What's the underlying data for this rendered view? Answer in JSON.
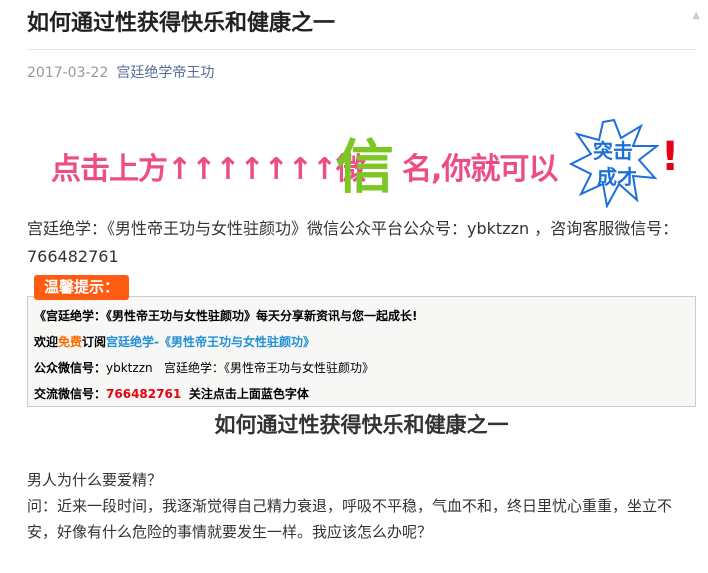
{
  "article": {
    "title": "如何通过性获得快乐和健康之一",
    "date": "2017-03-22",
    "author": "宫廷绝学帝王功"
  },
  "banner": {
    "text_left": "点击上方",
    "arrows": "↑↑↑↑↑↑↑",
    "text_wei": "微",
    "text_big": "信",
    "text_right": "名,你就可以",
    "badge_text_1": "突击",
    "badge_text_2": "成才",
    "exclaim": "!",
    "colors": {
      "pink": "#ec4d87",
      "green": "#7cc723",
      "red": "#e60012",
      "blue": "#1e6fd9"
    }
  },
  "intro": {
    "text": "宫廷绝学：《男性帝王功与女性驻颜功》微信公众平台公众号：ybktzzn ，咨询客服微信号：766482761"
  },
  "notice": {
    "tag": "温馨提示：",
    "line1": "《宫廷绝学：《男性帝王功与女性驻颜功》每天分享新资讯与您一起成长!",
    "line2_prefix": "欢迎",
    "line2_free": "免费",
    "line2_sub": "订阅",
    "line2_link": "宫廷绝学-《男性帝王功与女性驻颜功》",
    "line3_label": "公众微信号：",
    "line3_value": "ybktzzn",
    "line3_name": "宫廷绝学：《男性帝王功与女性驻颜功》",
    "line4_label": "交流微信号：",
    "line4_value": "766482761",
    "line4_hint": "关注点击上面蓝色字体"
  },
  "content": {
    "heading": "如何通过性获得快乐和健康之一",
    "p1": "男人为什么要爱精？",
    "p2": "问：近来一段时间，我逐渐觉得自己精力衰退，呼吸不平稳，气血不和，终日里忧心重重，坐立不安，好像有什么危险的事情就要发生一样。我应该怎么办呢？"
  }
}
